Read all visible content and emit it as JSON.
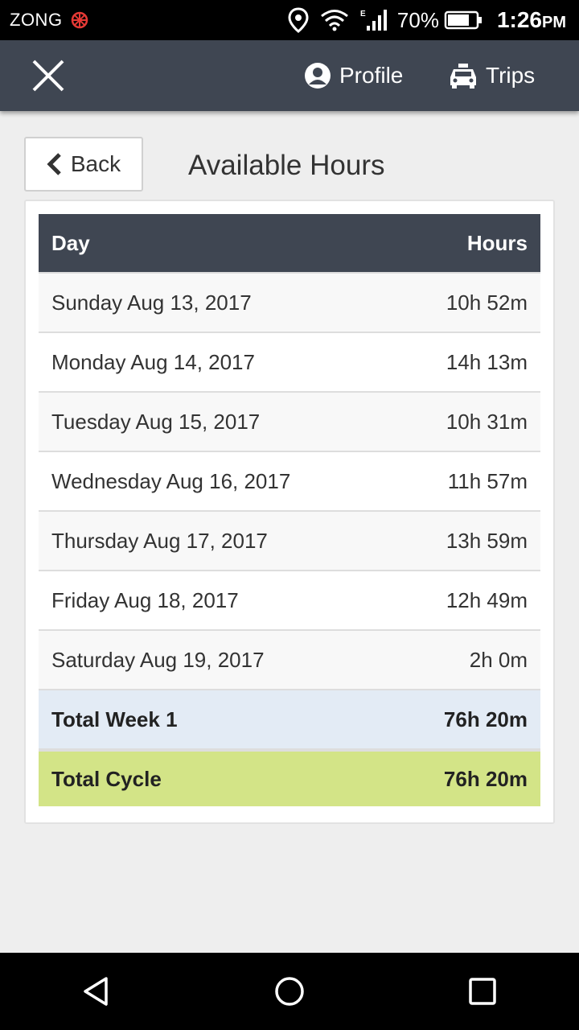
{
  "status_bar": {
    "carrier": "ZONG",
    "battery": "70%",
    "time": "1:26",
    "time_suffix": "PM"
  },
  "app_bar": {
    "close_icon": "close-icon",
    "nav": [
      {
        "label": "Profile",
        "icon": "profile-icon"
      },
      {
        "label": "Trips",
        "icon": "car-icon"
      }
    ]
  },
  "page": {
    "back_label": "Back",
    "title": "Available Hours"
  },
  "table": {
    "headers": {
      "day": "Day",
      "hours": "Hours"
    },
    "rows": [
      {
        "day": "Sunday Aug 13, 2017",
        "hours": "10h 52m"
      },
      {
        "day": "Monday Aug 14, 2017",
        "hours": "14h 13m"
      },
      {
        "day": "Tuesday Aug 15, 2017",
        "hours": "10h 31m"
      },
      {
        "day": "Wednesday Aug 16, 2017",
        "hours": "11h 57m"
      },
      {
        "day": "Thursday Aug 17, 2017",
        "hours": "13h 59m"
      },
      {
        "day": "Friday Aug 18, 2017",
        "hours": "12h 49m"
      },
      {
        "day": "Saturday Aug 19, 2017",
        "hours": "2h 0m"
      }
    ],
    "total_week": {
      "label": "Total Week 1",
      "hours": "76h 20m"
    },
    "total_cycle": {
      "label": "Total Cycle",
      "hours": "76h 20m"
    }
  },
  "colors": {
    "app_bar": "#3f4652",
    "total_week_bg": "#e3ebf5",
    "total_cycle_bg": "#d3e487"
  }
}
